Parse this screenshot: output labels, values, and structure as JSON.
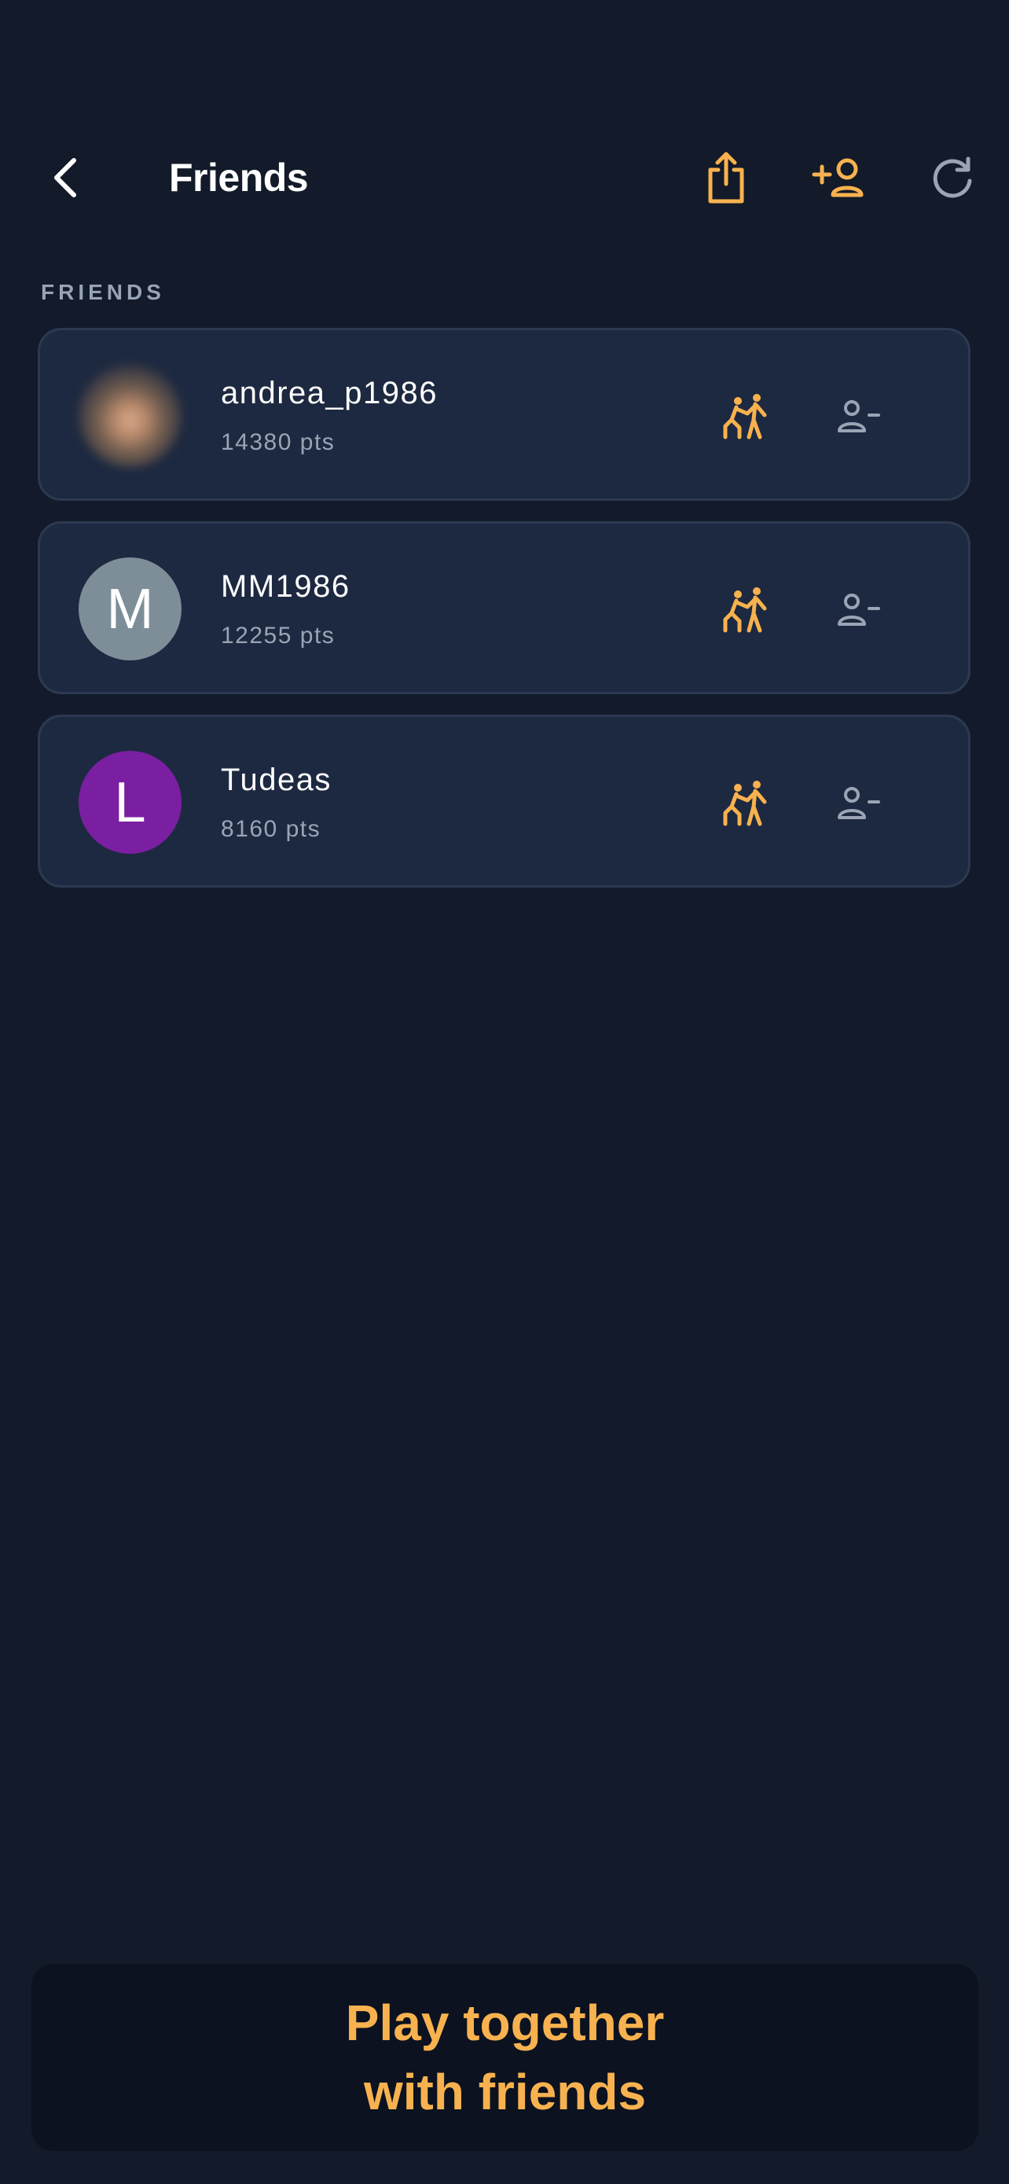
{
  "header": {
    "title": "Friends",
    "back_icon": "chevron-left-icon",
    "actions": [
      {
        "name": "share",
        "icon": "share-icon",
        "color": "#f7b24f"
      },
      {
        "name": "add-friend",
        "icon": "add-user-icon",
        "color": "#f7b24f"
      },
      {
        "name": "refresh",
        "icon": "refresh-icon",
        "color": "#9aa4b5"
      }
    ]
  },
  "section": {
    "label": "FRIENDS"
  },
  "friends": [
    {
      "name": "andrea_p1986",
      "points": "14380 pts",
      "avatar_type": "photo",
      "avatar_letter": "",
      "avatar_color": ""
    },
    {
      "name": "MM1986",
      "points": "12255 pts",
      "avatar_type": "letter",
      "avatar_letter": "M",
      "avatar_color": "#7d8e99"
    },
    {
      "name": "Tudeas",
      "points": "8160 pts",
      "avatar_type": "letter",
      "avatar_letter": "L",
      "avatar_color": "#7b1fa2"
    }
  ],
  "row_actions": {
    "play_icon": "play-together-icon",
    "remove_icon": "remove-friend-icon"
  },
  "cta": {
    "label": "Play together\nwith friends"
  },
  "colors": {
    "background": "#131a29",
    "card": "#1d2940",
    "accent": "#f7b24f",
    "muted": "#9aa4b5"
  }
}
